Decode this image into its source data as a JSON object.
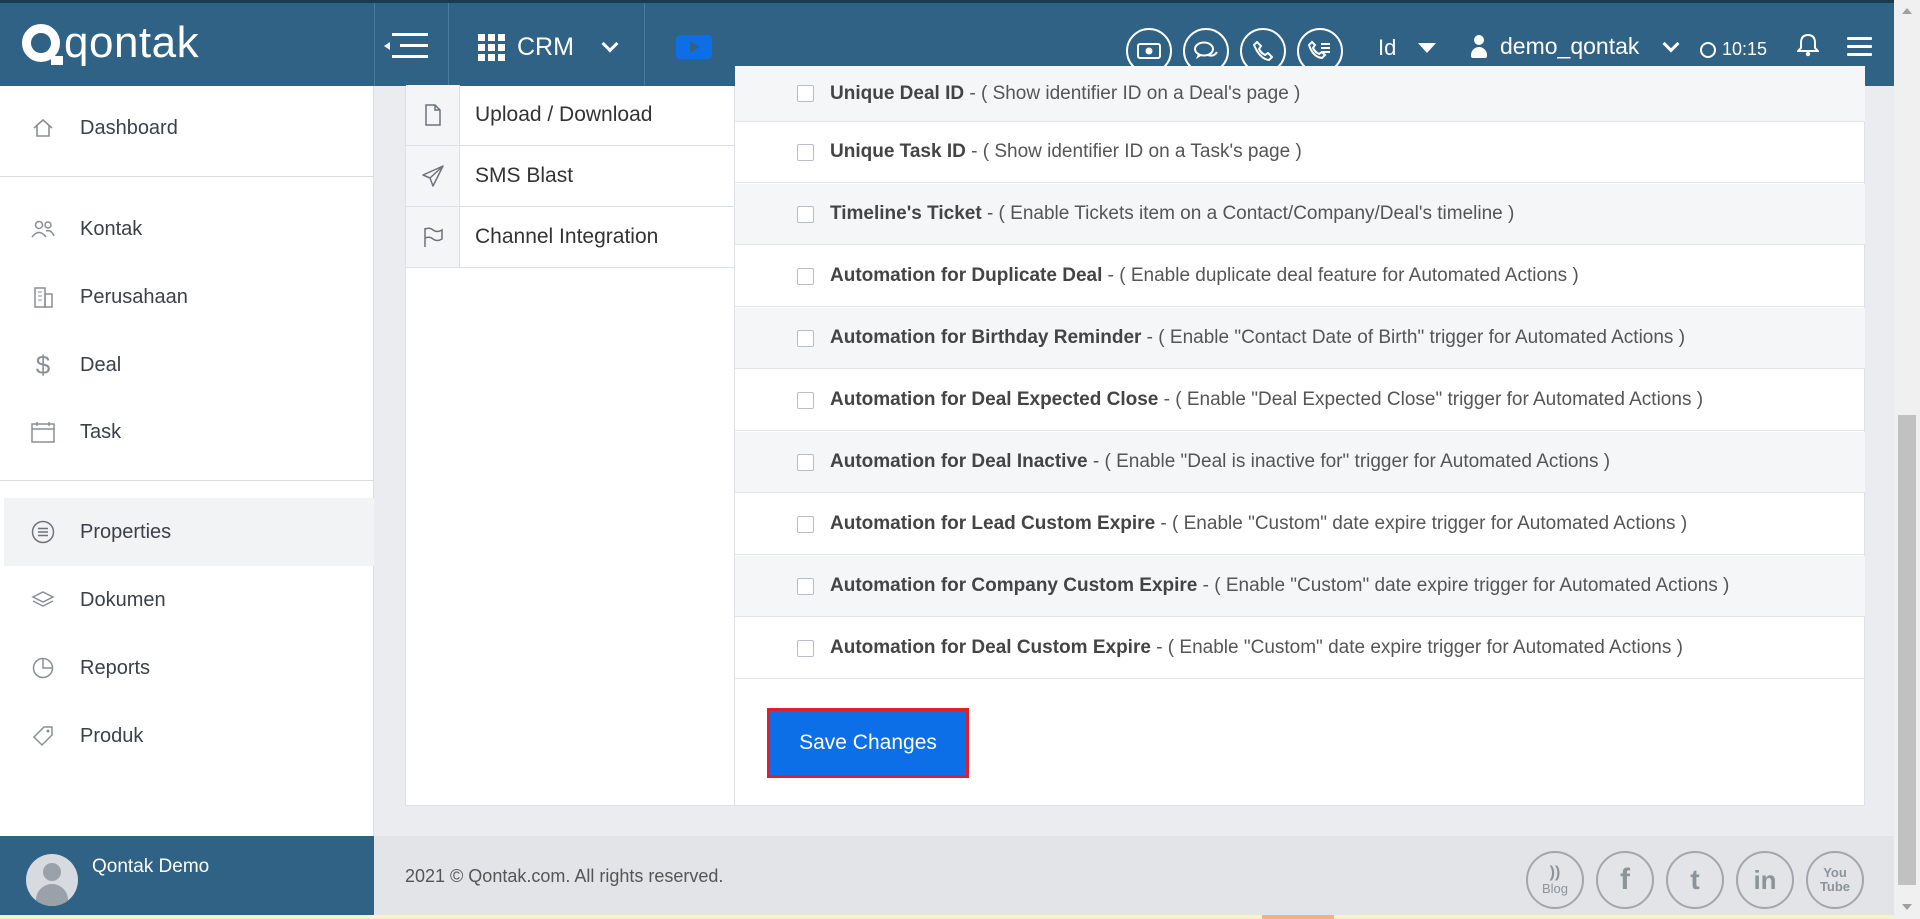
{
  "app": {
    "brand": "qontak",
    "module": "CRM",
    "language": "Id",
    "username": "demo_qontak",
    "time": "10:15",
    "colors": {
      "topbar": "#2f6285",
      "primary_button": "#0d6fe8",
      "highlight_border": "#e01f2c"
    },
    "header_icons": [
      "billing-icon",
      "chat-icon",
      "phone-icon",
      "call-log-icon"
    ]
  },
  "sidebar": {
    "items": [
      {
        "label": "Dashboard",
        "icon": "home-icon"
      },
      {
        "label": "Kontak",
        "icon": "people-icon"
      },
      {
        "label": "Perusahaan",
        "icon": "building-icon"
      },
      {
        "label": "Deal",
        "icon": "dollar-icon"
      },
      {
        "label": "Task",
        "icon": "calendar-icon"
      },
      {
        "label": "Properties",
        "icon": "list-icon"
      },
      {
        "label": "Dokumen",
        "icon": "layers-icon"
      },
      {
        "label": "Reports",
        "icon": "pie-chart-icon"
      },
      {
        "label": "Produk",
        "icon": "tag-icon"
      }
    ],
    "active": "Properties",
    "user_name": "Qontak Demo"
  },
  "settings_menu": [
    {
      "label": "Upload / Download",
      "icon": "file-icon"
    },
    {
      "label": "SMS Blast",
      "icon": "paper-plane-icon"
    },
    {
      "label": "Channel Integration",
      "icon": "flag-icon"
    }
  ],
  "options": [
    {
      "name": "Unique Deal ID",
      "desc": " - ( Show identifier ID on a Deal's page )",
      "checked": false
    },
    {
      "name": "Unique Task ID",
      "desc": " - ( Show identifier ID on a Task's page )",
      "checked": false
    },
    {
      "name": "Timeline's Ticket",
      "desc": " - ( Enable Tickets item on a Contact/Company/Deal's timeline )",
      "checked": false
    },
    {
      "name": "Automation for Duplicate Deal",
      "desc": " - ( Enable duplicate deal feature for Automated Actions )",
      "checked": false
    },
    {
      "name": "Automation for Birthday Reminder",
      "desc": " - ( Enable \"Contact Date of Birth\" trigger for Automated Actions )",
      "checked": false
    },
    {
      "name": "Automation for Deal Expected Close",
      "desc": " - ( Enable \"Deal Expected Close\" trigger for Automated Actions )",
      "checked": false
    },
    {
      "name": "Automation for Deal Inactive",
      "desc": " - ( Enable \"Deal is inactive for\" trigger for Automated Actions )",
      "checked": false
    },
    {
      "name": "Automation for Lead Custom Expire",
      "desc": " - ( Enable \"Custom\" date expire trigger for Automated Actions )",
      "checked": false
    },
    {
      "name": "Automation for Company Custom Expire",
      "desc": " - ( Enable \"Custom\" date expire trigger for Automated Actions )",
      "checked": false
    },
    {
      "name": "Automation for Deal Custom Expire",
      "desc": " - ( Enable \"Custom\" date expire trigger for Automated Actions )",
      "checked": false
    }
  ],
  "save_label": "Save Changes",
  "footer": {
    "copyright": "2021 © Qontak.com. All rights reserved.",
    "social": [
      {
        "glyph": "))",
        "label": "Blog",
        "icon": "rss-icon"
      },
      {
        "glyph": "f",
        "label": "",
        "icon": "facebook-icon"
      },
      {
        "glyph": "t",
        "label": "",
        "icon": "twitter-icon"
      },
      {
        "glyph": "in",
        "label": "",
        "icon": "linkedin-icon"
      },
      {
        "glyph": "You",
        "label": "Tube",
        "icon": "youtube-icon"
      }
    ]
  }
}
